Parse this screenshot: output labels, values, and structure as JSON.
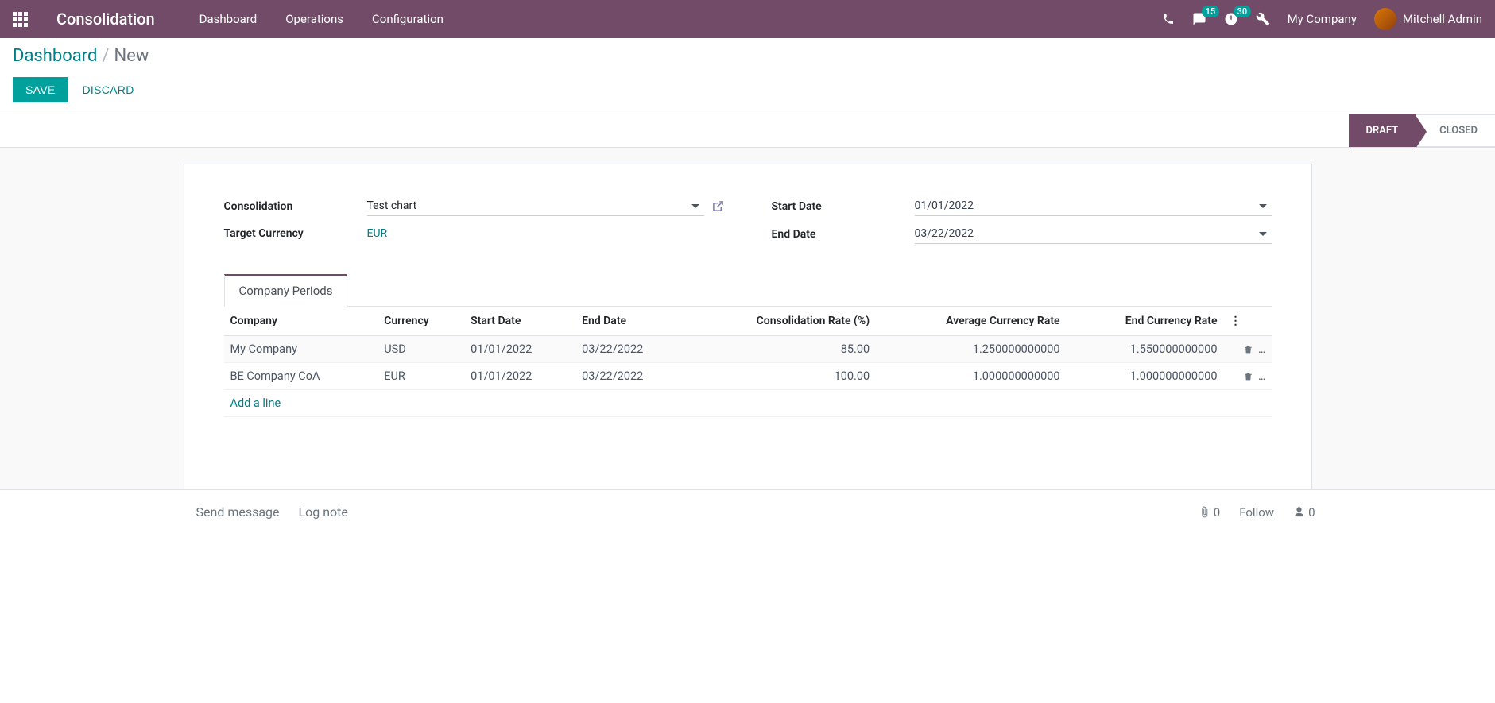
{
  "nav": {
    "brand": "Consolidation",
    "menu": [
      "Dashboard",
      "Operations",
      "Configuration"
    ],
    "messaging_count": "15",
    "activity_count": "30",
    "company": "My Company",
    "user": "Mitchell Admin"
  },
  "breadcrumb": {
    "root": "Dashboard",
    "current": "New"
  },
  "buttons": {
    "save": "SAVE",
    "discard": "DISCARD"
  },
  "status": {
    "draft": "DRAFT",
    "closed": "CLOSED"
  },
  "form": {
    "labels": {
      "consolidation": "Consolidation",
      "target_currency": "Target Currency",
      "start_date": "Start Date",
      "end_date": "End Date"
    },
    "consolidation_value": "Test chart",
    "target_currency": "EUR",
    "start_date": "01/01/2022",
    "end_date": "03/22/2022"
  },
  "tabs": {
    "company_periods": "Company Periods"
  },
  "table": {
    "headers": {
      "company": "Company",
      "currency": "Currency",
      "start_date": "Start Date",
      "end_date": "End Date",
      "consolidation_rate": "Consolidation Rate (%)",
      "avg_rate": "Average Currency Rate",
      "end_rate": "End Currency Rate"
    },
    "rows": [
      {
        "company": "My Company",
        "currency": "USD",
        "start_date": "01/01/2022",
        "end_date": "03/22/2022",
        "rate": "85.00",
        "avg": "1.250000000000",
        "end": "1.550000000000"
      },
      {
        "company": "BE Company CoA",
        "currency": "EUR",
        "start_date": "01/01/2022",
        "end_date": "03/22/2022",
        "rate": "100.00",
        "avg": "1.000000000000",
        "end": "1.000000000000"
      }
    ],
    "add_line": "Add a line"
  },
  "chatter": {
    "send_message": "Send message",
    "log_note": "Log note",
    "attach_count": "0",
    "follow": "Follow",
    "followers_count": "0"
  }
}
